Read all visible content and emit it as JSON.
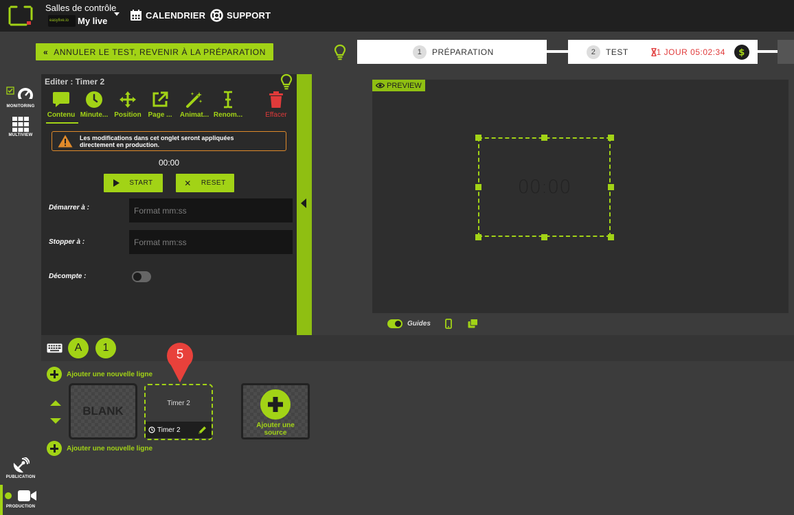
{
  "topbar": {
    "control_rooms_label": "Salles de contrôle",
    "live_logo_text": "easylive.io",
    "live_name": "My live",
    "calendar_label": "CALENDRIER",
    "support_label": "SUPPORT"
  },
  "actionbar": {
    "cancel_test_label": "ANNULER LE TEST, REVENIR À LA PRÉPARATION",
    "steps": [
      {
        "number": "1",
        "label": "PRÉPARATION"
      },
      {
        "number": "2",
        "label": "TEST"
      }
    ],
    "countdown": "1 JOUR 05:02:34"
  },
  "rail": {
    "monitoring_label": "MONITORING",
    "multiview_label": "MULTIVIEW",
    "publication_label": "PUBLICATION",
    "production_label": "PRODUCTION"
  },
  "editor": {
    "title": "Editer : Timer 2",
    "tools": [
      {
        "label": "Contenu"
      },
      {
        "label": "Minute..."
      },
      {
        "label": "Position"
      },
      {
        "label": "Page ..."
      },
      {
        "label": "Animat..."
      },
      {
        "label": "Renom..."
      },
      {
        "label": "Effacer"
      }
    ],
    "warning": "Les modifications dans cet onglet seront appliquées directement en production.",
    "timer_value": "00:00",
    "start_label": "START",
    "reset_label": "RESET",
    "start_at_label": "Démarrer à :",
    "start_at_placeholder": "Format mm:ss",
    "stop_at_label": "Stopper à :",
    "stop_at_placeholder": "Format mm:ss",
    "countdown_label": "Décompte :",
    "countdown_enabled": false
  },
  "preview": {
    "tag": "PREVIEW",
    "timer_display": "00:00",
    "guides_label": "Guides",
    "guides_enabled": true
  },
  "layers": {
    "layer_a": "A",
    "layer_1": "1"
  },
  "scenes": {
    "add_line_label": "Ajouter une nouvelle ligne",
    "blank_label": "BLANK",
    "timer_card_title": "Timer 2",
    "timer_card_footer": "Timer 2",
    "pin_number": "5",
    "add_source_label": "Ajouter une source"
  },
  "colors": {
    "accent": "#a2d316",
    "danger": "#e03a3a",
    "warning": "#e08a2a"
  }
}
